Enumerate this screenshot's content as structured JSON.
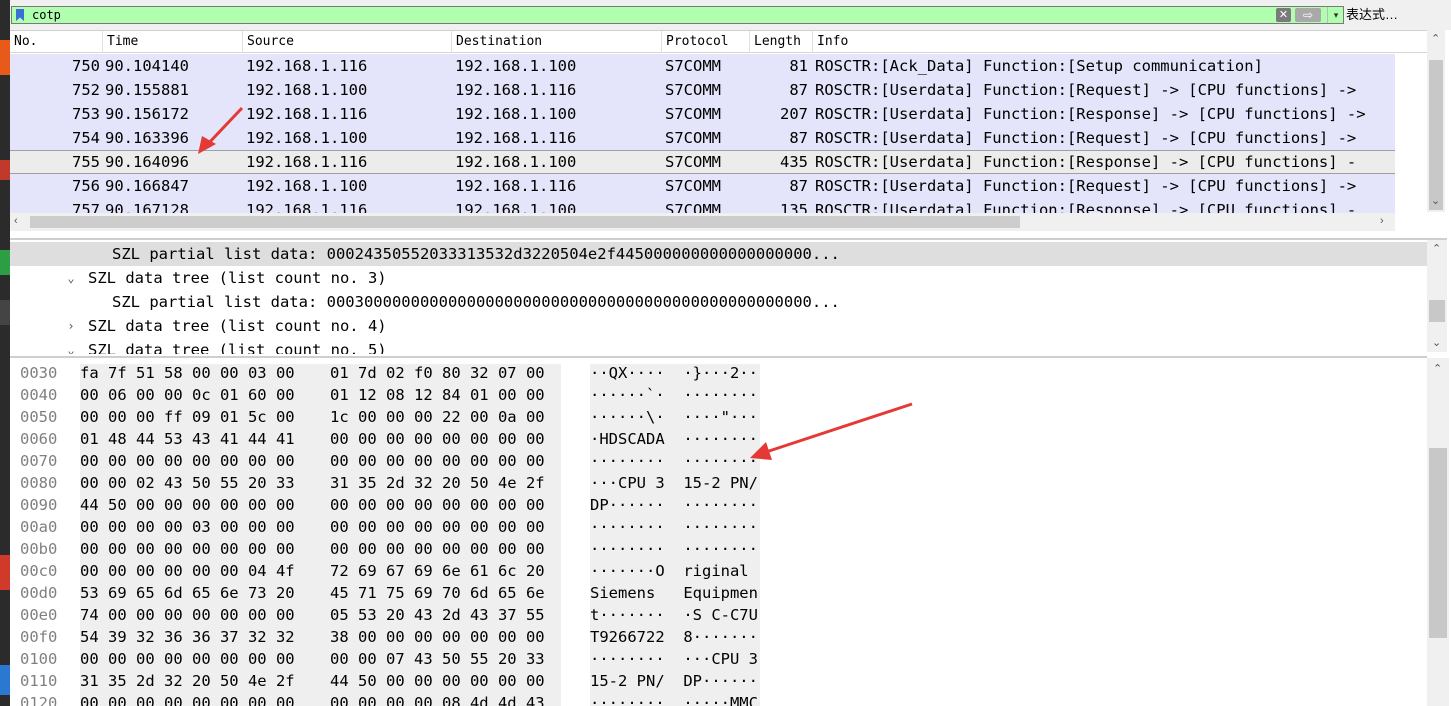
{
  "filter": {
    "value": "cotp",
    "clear_glyph": "✕",
    "apply_glyph": "⇨",
    "dropdown_glyph": "▾",
    "expression_label": "表达式…"
  },
  "packet_list": {
    "columns": [
      "No.",
      "Time",
      "Source",
      "Destination",
      "Protocol",
      "Length",
      "Info"
    ],
    "rows": [
      {
        "no": "750",
        "time": "90.104140",
        "src": "192.168.1.116",
        "dst": "192.168.1.100",
        "proto": "S7COMM",
        "len": "81",
        "info": "ROSCTR:[Ack_Data] Function:[Setup communication]"
      },
      {
        "no": "752",
        "time": "90.155881",
        "src": "192.168.1.100",
        "dst": "192.168.1.116",
        "proto": "S7COMM",
        "len": "87",
        "info": "ROSCTR:[Userdata] Function:[Request] -> [CPU functions] ->"
      },
      {
        "no": "753",
        "time": "90.156172",
        "src": "192.168.1.116",
        "dst": "192.168.1.100",
        "proto": "S7COMM",
        "len": "207",
        "info": "ROSCTR:[Userdata] Function:[Response] -> [CPU functions] ->"
      },
      {
        "no": "754",
        "time": "90.163396",
        "src": "192.168.1.100",
        "dst": "192.168.1.116",
        "proto": "S7COMM",
        "len": "87",
        "info": "ROSCTR:[Userdata] Function:[Request] -> [CPU functions] ->"
      },
      {
        "no": "755",
        "time": "90.164096",
        "src": "192.168.1.116",
        "dst": "192.168.1.100",
        "proto": "S7COMM",
        "len": "435",
        "info": "ROSCTR:[Userdata] Function:[Response] -> [CPU functions] -"
      },
      {
        "no": "756",
        "time": "90.166847",
        "src": "192.168.1.100",
        "dst": "192.168.1.116",
        "proto": "S7COMM",
        "len": "87",
        "info": "ROSCTR:[Userdata] Function:[Request] -> [CPU functions] ->"
      },
      {
        "no": "757",
        "time": "90.167128",
        "src": "192.168.1.116",
        "dst": "192.168.1.100",
        "proto": "S7COMM",
        "len": "135",
        "info": "ROSCTR:[Userdata] Function:[Response] -> [CPU functions] -"
      }
    ]
  },
  "details": {
    "lines": [
      {
        "text": "SZL partial list data: 00024350552033313532d3220504e2f445000000000000000000...",
        "chevron": ""
      },
      {
        "text": "SZL data tree (list count no. 3)",
        "chevron": "⌄"
      },
      {
        "text": "SZL partial list data: 0003000000000000000000000000000000000000000000000000...",
        "chevron": ""
      },
      {
        "text": "SZL data tree (list count no. 4)",
        "chevron": "›"
      },
      {
        "text": "SZL data tree (list count no. 5)",
        "chevron": "⌄"
      }
    ]
  },
  "hex": {
    "rows": [
      {
        "off": "0030",
        "b1": "fa 7f 51 58 00 00 03 00",
        "b2": "01 7d 02 f0 80 32 07 00",
        "ascii": "··QX····  ·}···2··"
      },
      {
        "off": "0040",
        "b1": "00 06 00 00 0c 01 60 00",
        "b2": "01 12 08 12 84 01 00 00",
        "ascii": "······`·  ········"
      },
      {
        "off": "0050",
        "b1": "00 00 00 ff 09 01 5c 00",
        "b2": "1c 00 00 00 22 00 0a 00",
        "ascii": "······\\·  ····\"···"
      },
      {
        "off": "0060",
        "b1": "01 48 44 53 43 41 44 41",
        "b2": "00 00 00 00 00 00 00 00",
        "ascii": "·HDSCADA  ········"
      },
      {
        "off": "0070",
        "b1": "00 00 00 00 00 00 00 00",
        "b2": "00 00 00 00 00 00 00 00",
        "ascii": "········  ········"
      },
      {
        "off": "0080",
        "b1": "00 00 02 43 50 55 20 33",
        "b2": "31 35 2d 32 20 50 4e 2f",
        "ascii": "···CPU 3  15-2 PN/"
      },
      {
        "off": "0090",
        "b1": "44 50 00 00 00 00 00 00",
        "b2": "00 00 00 00 00 00 00 00",
        "ascii": "DP······  ········"
      },
      {
        "off": "00a0",
        "b1": "00 00 00 00 03 00 00 00",
        "b2": "00 00 00 00 00 00 00 00",
        "ascii": "········  ········"
      },
      {
        "off": "00b0",
        "b1": "00 00 00 00 00 00 00 00",
        "b2": "00 00 00 00 00 00 00 00",
        "ascii": "········  ········"
      },
      {
        "off": "00c0",
        "b1": "00 00 00 00 00 00 04 4f",
        "b2": "72 69 67 69 6e 61 6c 20",
        "ascii": "·······O  riginal "
      },
      {
        "off": "00d0",
        "b1": "53 69 65 6d 65 6e 73 20",
        "b2": "45 71 75 69 70 6d 65 6e",
        "ascii": "Siemens   Equipmen"
      },
      {
        "off": "00e0",
        "b1": "74 00 00 00 00 00 00 00",
        "b2": "05 53 20 43 2d 43 37 55",
        "ascii": "t·······  ·S C-C7U"
      },
      {
        "off": "00f0",
        "b1": "54 39 32 36 36 37 32 32",
        "b2": "38 00 00 00 00 00 00 00",
        "ascii": "T9266722  8·······"
      },
      {
        "off": "0100",
        "b1": "00 00 00 00 00 00 00 00",
        "b2": "00 00 07 43 50 55 20 33",
        "ascii": "········  ···CPU 3"
      },
      {
        "off": "0110",
        "b1": "31 35 2d 32 20 50 4e 2f",
        "b2": "44 50 00 00 00 00 00 00",
        "ascii": "15-2 PN/  DP······"
      },
      {
        "off": "0120",
        "b1": "00 00 00 00 00 00 00 00",
        "b2": "00 00 00 00 08 4d 4d 43",
        "ascii": "········  ·····MMC"
      }
    ]
  },
  "colors": {
    "filter_ok": "#afffaf",
    "row_bg": "#e4e4fa",
    "selected_row": "#ececec",
    "hex_bg": "#efefef",
    "annotation": "#e53935"
  }
}
